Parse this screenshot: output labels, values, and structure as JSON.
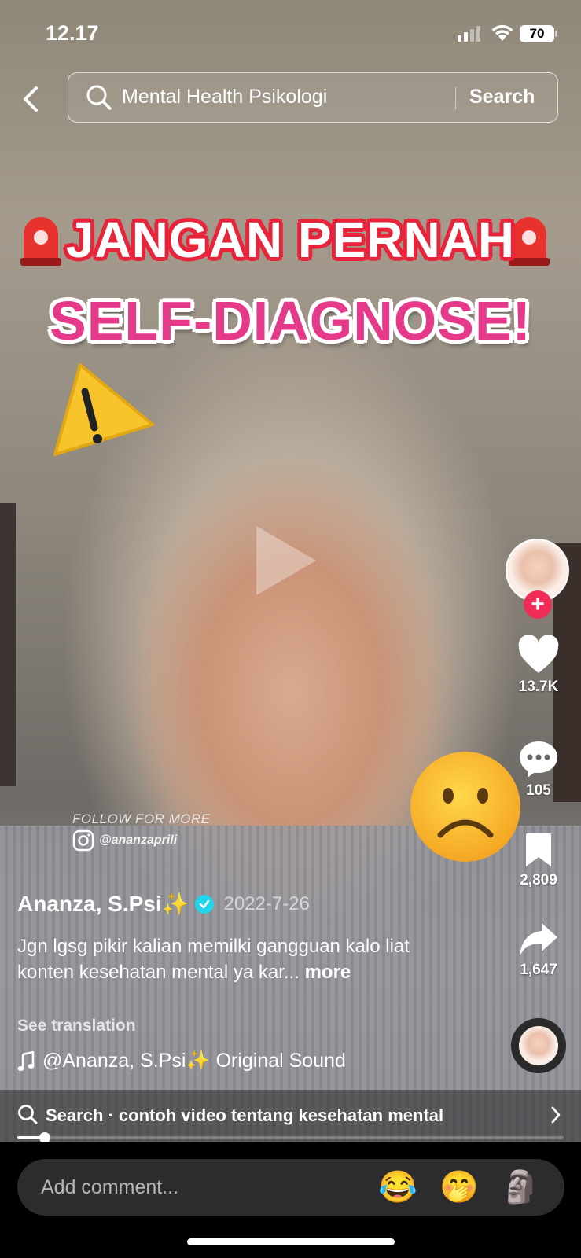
{
  "status_bar": {
    "time": "12.17",
    "battery": "70"
  },
  "search": {
    "query": "Mental Health Psikologi",
    "button_label": "Search"
  },
  "video": {
    "headline_line1": "JANGAN PERNAH",
    "headline_line2": "SELF-DIAGNOSE!",
    "watermark_text": "FOLLOW FOR MORE",
    "watermark_handle": "@ananzaprili"
  },
  "rail": {
    "likes": "13.7K",
    "comments": "105",
    "saves": "2,809",
    "shares": "1,647"
  },
  "post": {
    "creator": "Ananza, S.Psi✨",
    "date": "2022-7-26",
    "caption": "Jgn lgsg pikir kalian memilki gangguan kalo liat konten kesehatan mental ya kar...",
    "more_label": "more",
    "see_translation": "See translation",
    "sound": "@Ananza, S.Psi✨ Original Sound"
  },
  "suggestion": {
    "text": "Search · contoh video tentang kesehatan mental"
  },
  "playback": {
    "progress_fraction": 0.05
  },
  "comment_bar": {
    "placeholder": "Add comment...",
    "emojis": [
      "😂",
      "🤭",
      "🗿"
    ]
  },
  "colors": {
    "like_accent": "#f02c56",
    "verified": "#20d5ec",
    "headline_red": "#e8243a",
    "headline_pink": "#e5398a"
  }
}
